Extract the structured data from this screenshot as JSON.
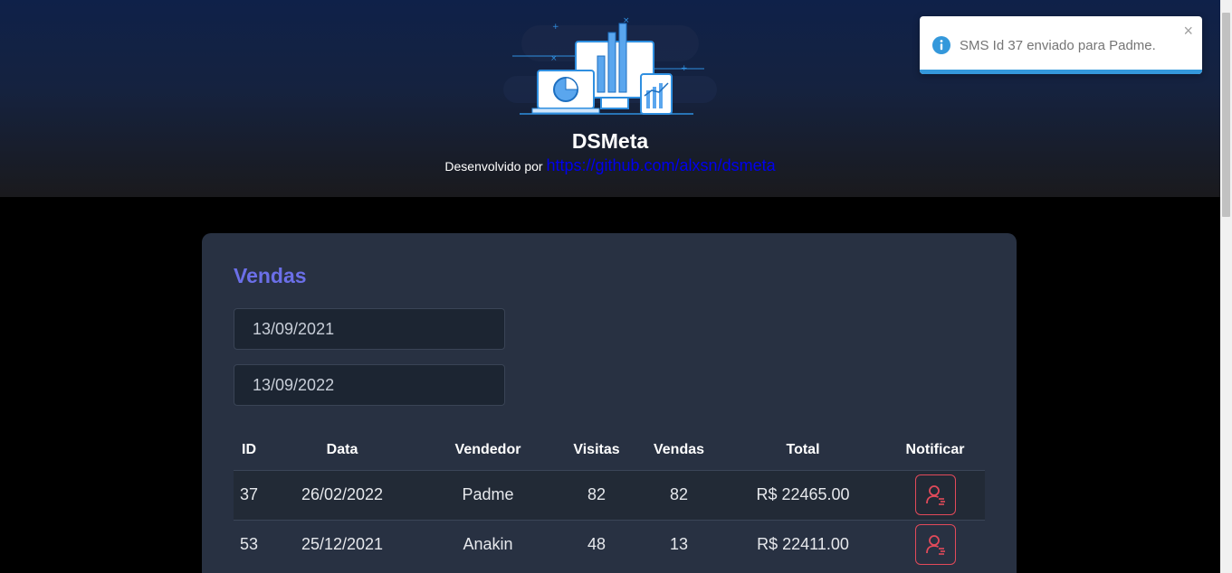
{
  "header": {
    "title": "DSMeta",
    "dev_prefix": "Desenvolvido por",
    "dev_link": "https://github.com/alxsn/dsmeta"
  },
  "sales": {
    "title": "Vendas",
    "min_date": "13/09/2021",
    "max_date": "13/09/2022",
    "columns": [
      "ID",
      "Data",
      "Vendedor",
      "Visitas",
      "Vendas",
      "Total",
      "Notificar"
    ],
    "rows": [
      {
        "id": "37",
        "date": "26/02/2022",
        "seller": "Padme",
        "visits": "82",
        "deals": "82",
        "total": "R$ 22465.00"
      },
      {
        "id": "53",
        "date": "25/12/2021",
        "seller": "Anakin",
        "visits": "48",
        "deals": "13",
        "total": "R$ 22411.00"
      }
    ]
  },
  "toast": {
    "message": "SMS Id 37 enviado para Padme.",
    "close_symbol": "×",
    "progress": 1.0
  },
  "colors": {
    "accent": "#6b6fe8",
    "notify": "#e24a5a",
    "toast_info": "#3498db"
  }
}
